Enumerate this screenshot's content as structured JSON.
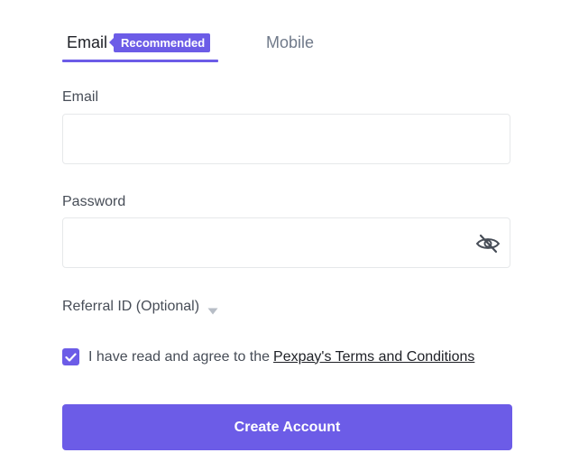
{
  "tabs": {
    "email": {
      "label": "Email",
      "badge": "Recommended",
      "active": true
    },
    "mobile": {
      "label": "Mobile",
      "active": false
    }
  },
  "form": {
    "email": {
      "label": "Email",
      "value": "",
      "placeholder": ""
    },
    "password": {
      "label": "Password",
      "value": "",
      "placeholder": "",
      "visibility_icon": "eye-off-icon"
    },
    "referral": {
      "label": "Referral ID (Optional)",
      "icon": "caret-down-icon"
    },
    "agreement": {
      "checked": true,
      "text": "I have read and agree to the",
      "link_text": "Pexpay's Terms and Conditions"
    },
    "submit_label": "Create Account"
  },
  "colors": {
    "accent": "#6c5ce7",
    "text_primary": "#1e2026",
    "text_secondary": "#474d57",
    "text_muted": "#707a8a",
    "border": "#e6e8ea",
    "icon_gray": "#b7bdc6"
  }
}
